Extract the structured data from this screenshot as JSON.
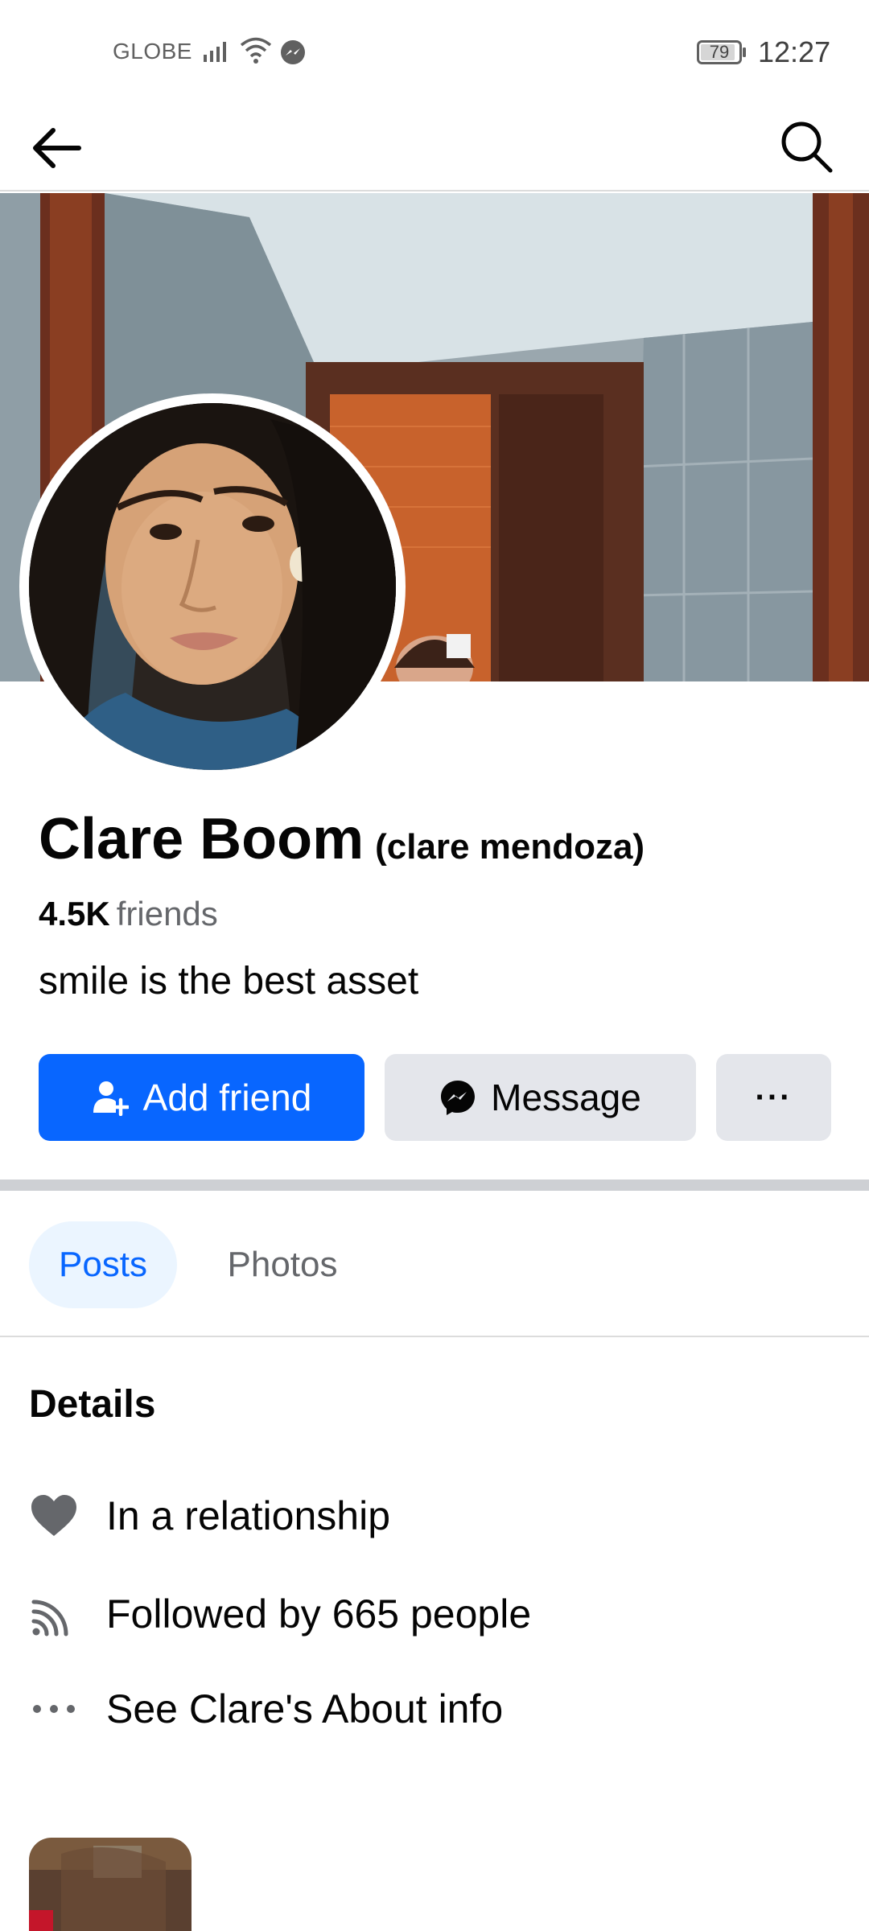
{
  "status_bar": {
    "carrier": "GLOBE",
    "battery": "79",
    "time": "12:27"
  },
  "nav": {
    "back_icon": "arrow-left-icon",
    "search_icon": "search-icon"
  },
  "profile": {
    "name": "Clare Boom",
    "alternate_name": "(clare mendoza)",
    "friends_count": "4.5K",
    "friends_label": "friends",
    "bio": "smile is the best asset"
  },
  "actions": {
    "add_friend": "Add friend",
    "message": "Message",
    "more": "···"
  },
  "tabs": [
    {
      "label": "Posts",
      "selected": true
    },
    {
      "label": "Photos",
      "selected": false
    }
  ],
  "details": {
    "title": "Details",
    "items": [
      {
        "icon": "heart-icon",
        "text": "In a relationship"
      },
      {
        "icon": "rss-feed-icon",
        "text": "Followed by 665 people"
      },
      {
        "icon": "more-dots-icon",
        "text": "See Clare's About info"
      }
    ]
  },
  "colors": {
    "accent": "#0866ff",
    "secondary_button": "#e4e6eb",
    "tab_selected_bg": "#ebf5ff",
    "muted_text": "#65676b"
  }
}
